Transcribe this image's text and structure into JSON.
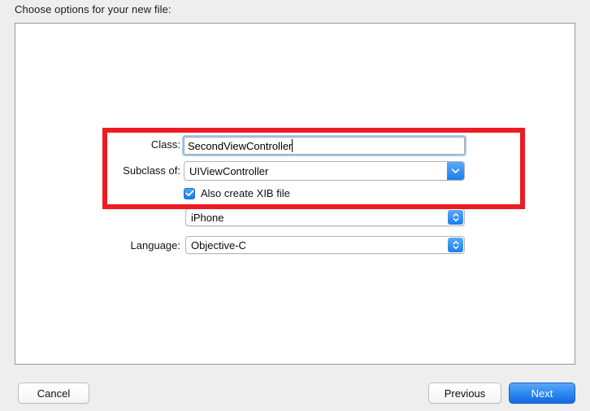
{
  "header": {
    "prompt": "Choose options for your new file:"
  },
  "form": {
    "class_row": {
      "label": "Class:",
      "value": "SecondViewController"
    },
    "subclass_row": {
      "label": "Subclass of:",
      "value": "UIViewController",
      "chevron_icon": "chevron-down-icon"
    },
    "xib_row": {
      "label": "Also create XIB file",
      "checked": true,
      "check_icon": "checkmark-icon"
    },
    "device_row": {
      "label": "",
      "value": "iPhone",
      "chevron_icon": "chevron-up-down-icon"
    },
    "language_row": {
      "label": "Language:",
      "value": "Objective-C",
      "chevron_icon": "chevron-up-down-icon"
    }
  },
  "annotation": {
    "color": "#ed1c24"
  },
  "footer": {
    "cancel_label": "Cancel",
    "previous_label": "Previous",
    "next_label": "Next",
    "next_accent": "#2f8bf3"
  }
}
